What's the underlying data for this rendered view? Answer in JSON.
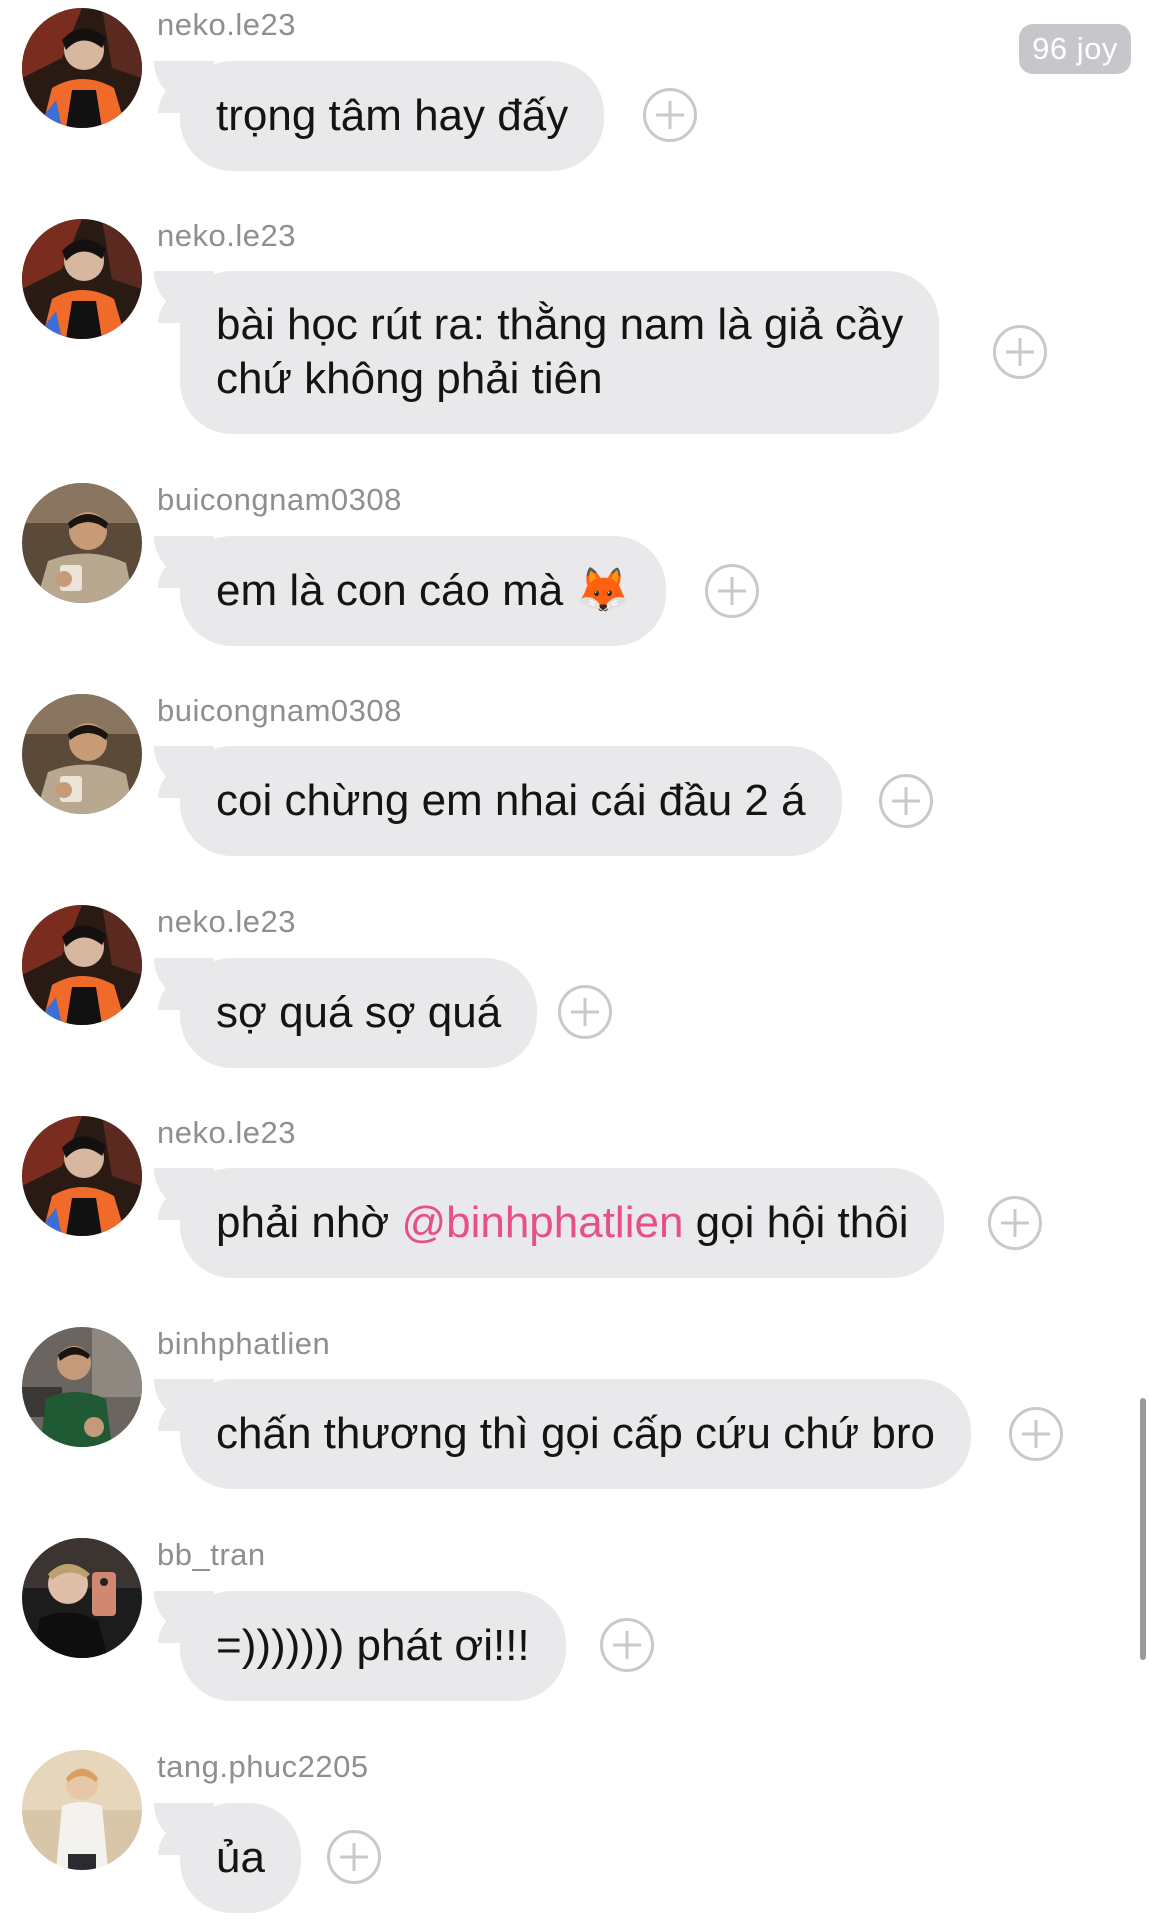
{
  "badge": {
    "label": "96 joy"
  },
  "messages": [
    {
      "user": "neko.le23",
      "text": "trọng tâm hay đấy"
    },
    {
      "user": "neko.le23",
      "text_line1": "bài học rút ra: thằng nam là giả cầy",
      "text_line2": "chứ không phải tiên"
    },
    {
      "user": "buicongnam0308",
      "text": "em là con cáo mà 🦊"
    },
    {
      "user": "buicongnam0308",
      "text": "coi chừng em nhai cái đầu 2 á"
    },
    {
      "user": "neko.le23",
      "text": "sợ quá sợ quá"
    },
    {
      "user": "neko.le23",
      "text_before": "phải nhờ ",
      "mention": "@binhphatlien",
      "text_after": " gọi hội thôi"
    },
    {
      "user": "binhphatlien",
      "text": "chấn thương thì gọi cấp cứu chứ bro"
    },
    {
      "user": "bb_tran",
      "text": "=))))))) phát ơi!!!"
    },
    {
      "user": "tang.phuc2205",
      "text": "ủa"
    }
  ],
  "icons": {
    "add_reaction": "plus-circle-icon",
    "avatar": "avatar-photo"
  },
  "colors": {
    "bubble": "#e9e9eb",
    "mention": "#e64f8a",
    "username": "#8e8e93",
    "badge_bg": "#c7c7cb"
  }
}
